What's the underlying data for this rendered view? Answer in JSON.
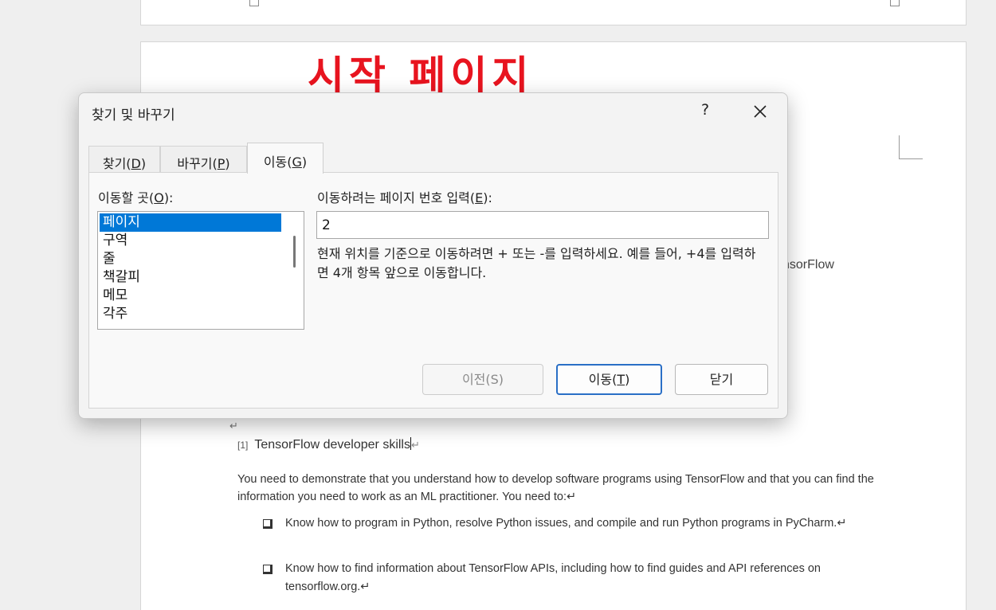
{
  "annotation": {
    "text": "시작 페이지"
  },
  "document": {
    "partial_right_text": "nsorFlow",
    "paragraph_mark": "↵",
    "heading": {
      "number": "[1]",
      "text": "TensorFlow developer skills",
      "mark": "↵"
    },
    "body": "You need to demonstrate that you understand how to develop software programs using TensorFlow and that you can find the information you need to work as an ML practitioner. You need to:↵",
    "bullets": [
      {
        "text": "Know how to program in Python, resolve Python issues, and compile and run Python programs in PyCharm.↵"
      },
      {
        "text": "Know how to find information about TensorFlow APIs, including how to find guides and API references on tensorflow.org.↵"
      }
    ]
  },
  "dialog": {
    "title": "찾기 및 바꾸기",
    "help_label": "?",
    "tabs": [
      {
        "label": "찾기(",
        "key": "D",
        "close": ")"
      },
      {
        "label": "바꾸기(",
        "key": "P",
        "close": ")"
      },
      {
        "label": "이동(",
        "key": "G",
        "close": ")"
      }
    ],
    "goto_what_label": "이동할 곳(",
    "goto_what_key": "O",
    "goto_what_close": "):",
    "goto_items": [
      "페이지",
      "구역",
      "줄",
      "책갈피",
      "메모",
      "각주"
    ],
    "selected_item": "페이지",
    "enter_label": "이동하려는 페이지 번호 입력(",
    "enter_key": "E",
    "enter_close": "):",
    "input_value": "2",
    "hint": "현재 위치를 기준으로 이동하려면 + 또는 -를 입력하세요. 예를 들어, +4를 입력하면 4개 항목 앞으로 이동합니다.",
    "buttons": {
      "previous": "이전(S)",
      "goto_text": "이동(",
      "goto_key": "T",
      "goto_close": ")",
      "close": "닫기"
    },
    "colors": {
      "selection": "#0078d7",
      "default_button_border": "#2a6fc6"
    }
  }
}
